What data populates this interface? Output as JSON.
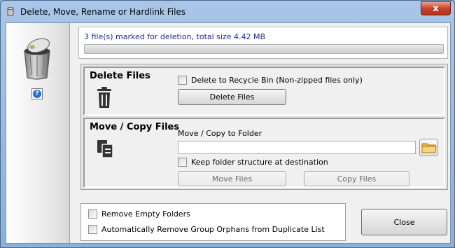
{
  "window": {
    "title": "Delete, Move, Rename or Hardlink Files",
    "close_glyph": "x"
  },
  "sidebar": {
    "icons": [
      "recycle-bin-icon",
      "help-icon"
    ],
    "help_glyph": "?"
  },
  "status": {
    "message": "3 file(s) marked for deletion, total size 4.42 MB",
    "progress": 0
  },
  "delete_panel": {
    "title": "Delete Files",
    "recycle_bin_checkbox": {
      "label": "Delete to Recycle Bin (Non-zipped files only)",
      "checked": false
    },
    "delete_button": "Delete Files"
  },
  "move_panel": {
    "title": "Move / Copy Files",
    "folder_label": "Move / Copy to Folder",
    "folder_value": "",
    "keep_structure_checkbox": {
      "label": "Keep folder structure at destination",
      "checked": false
    },
    "move_button": "Move Files",
    "copy_button": "Copy Files"
  },
  "options": {
    "remove_empty_folders": {
      "label": "Remove Empty Folders",
      "checked": false
    },
    "remove_orphans": {
      "label": "Automatically Remove Group Orphans from Duplicate List",
      "checked": false
    }
  },
  "close_button": "Close",
  "colors": {
    "status_text": "#1b2b8f",
    "titlebar": "#a9c6e8",
    "close_red": "#c7442a"
  }
}
